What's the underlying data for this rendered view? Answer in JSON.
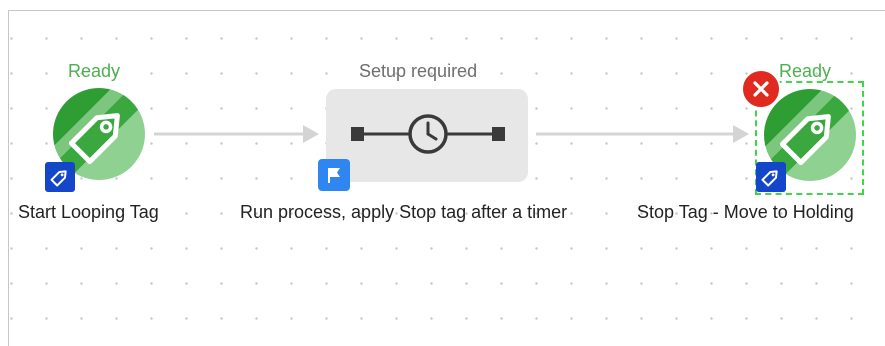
{
  "nodes": [
    {
      "id": "start",
      "status": "Ready",
      "label": "Start Looping Tag",
      "icon": "tag-icon",
      "badge_icon": "tag-icon"
    },
    {
      "id": "process",
      "status": "Setup required",
      "label": "Run process, apply Stop tag after a timer",
      "icon": "timer-icon",
      "badge_icon": "flag-icon"
    },
    {
      "id": "stop",
      "status": "Ready",
      "label": "Stop Tag - Move to Holding",
      "icon": "tag-icon",
      "badge_icon": "tag-icon",
      "error_icon": "close-icon",
      "selected": true
    }
  ],
  "colors": {
    "ready": "#4caf50",
    "setup": "#6e6e6e",
    "tag_badge": "#1346c8",
    "flag_badge": "#2f86f0",
    "error": "#e0291f",
    "selection": "#3dd64a",
    "connector": "#d4d4d4",
    "process_bg": "#e7e7e8"
  }
}
